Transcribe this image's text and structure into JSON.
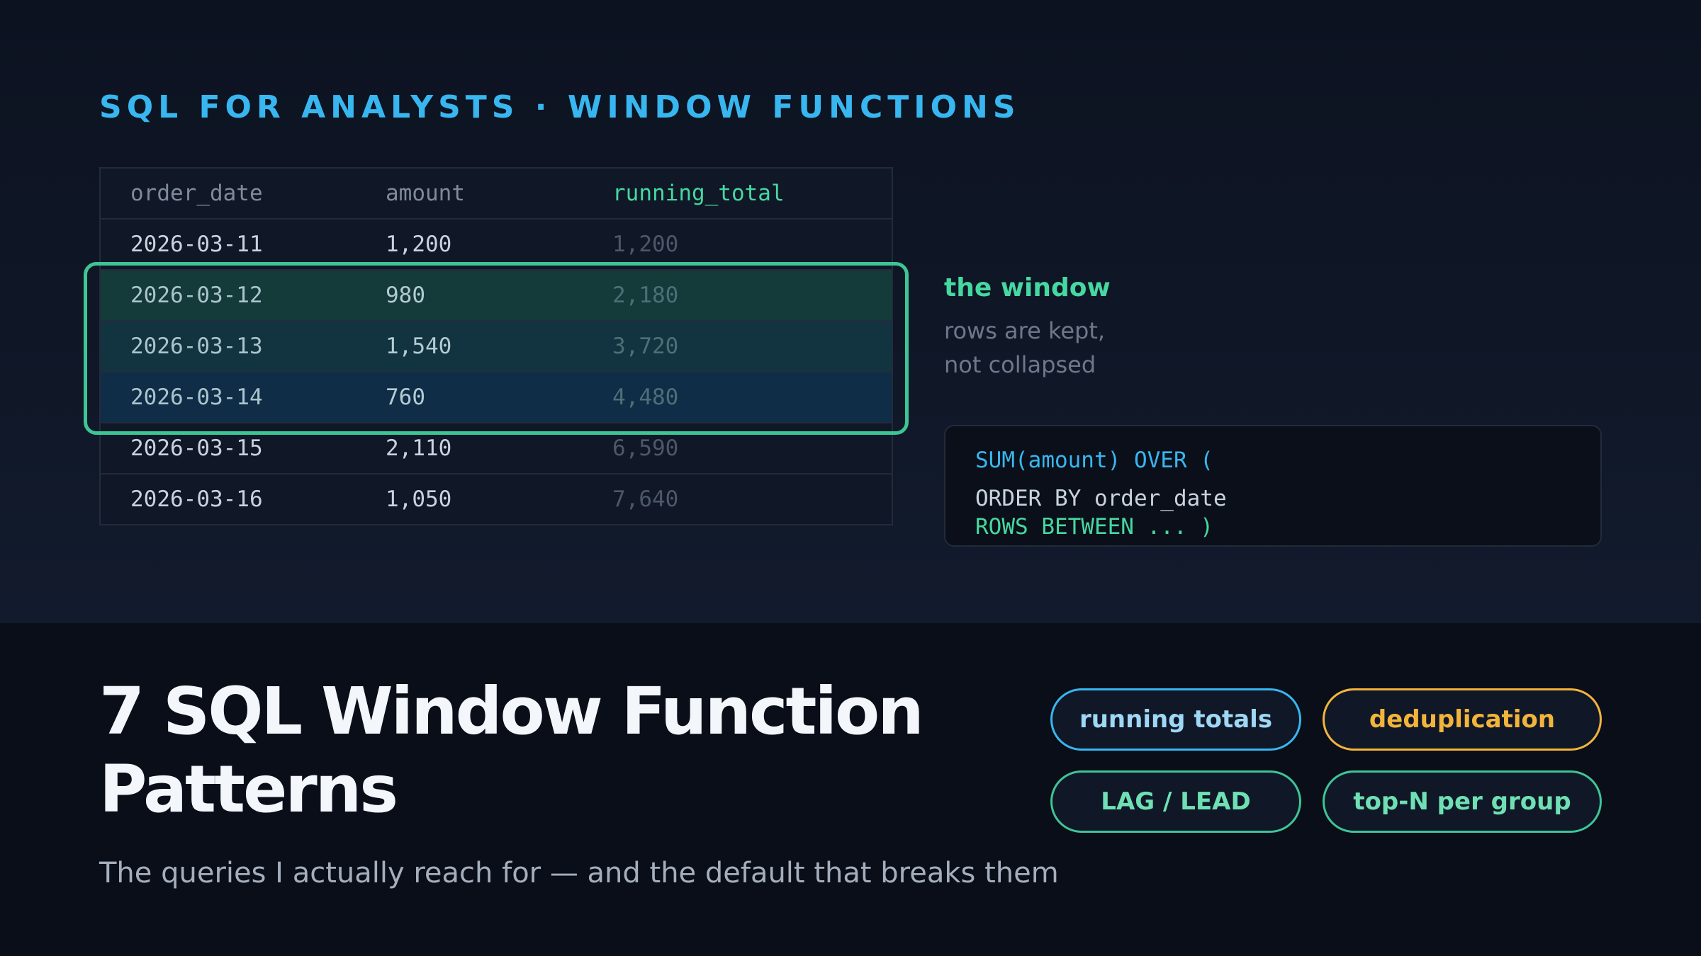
{
  "eyebrow": "SQL FOR ANALYSTS · WINDOW FUNCTIONS",
  "table": {
    "columns": [
      "order_date",
      "amount",
      "running_total"
    ],
    "rows": [
      [
        "2026-03-11",
        "1,200",
        "1,200"
      ],
      [
        "2026-03-12",
        "980",
        "2,180"
      ],
      [
        "2026-03-13",
        "1,540",
        "3,720"
      ],
      [
        "2026-03-14",
        "760",
        "4,480"
      ],
      [
        "2026-03-15",
        "2,110",
        "6,590"
      ],
      [
        "2026-03-16",
        "1,050",
        "7,640"
      ]
    ],
    "highlighted_rows": [
      1,
      2,
      3
    ]
  },
  "window_note": {
    "title": "the window",
    "line1": "rows are kept,",
    "line2": "not collapsed"
  },
  "code": {
    "line1": "SUM(amount) OVER (",
    "line2": "ORDER BY order_date",
    "line3": "ROWS BETWEEN ... )"
  },
  "headline": "7 SQL Window Function Patterns",
  "subtitle": "The queries I actually reach for — and the default that breaks them",
  "pills": [
    "running totals",
    "deduplication",
    "LAG / LEAD",
    "top-N per group"
  ],
  "colors": {
    "background": "#0b101b",
    "accent_blue": "#38b6f0",
    "accent_green": "#3ec596",
    "accent_amber": "#f3b43c",
    "headline": "#f3f6fa"
  }
}
